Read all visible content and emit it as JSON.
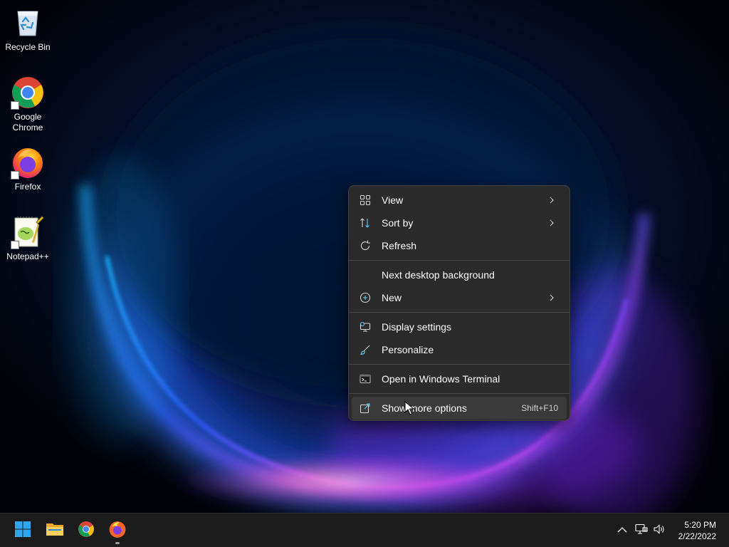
{
  "desktop": {
    "icons": [
      {
        "label": "Recycle Bin",
        "icon": "recycle-bin-icon"
      },
      {
        "label": "Google Chrome",
        "icon": "chrome-icon"
      },
      {
        "label": "Firefox",
        "icon": "firefox-icon"
      },
      {
        "label": "Notepad++",
        "icon": "notepadpp-icon"
      }
    ]
  },
  "context_menu": {
    "items": [
      {
        "label": "View",
        "icon": "grid-view-icon",
        "submenu": true
      },
      {
        "label": "Sort by",
        "icon": "sort-icon",
        "submenu": true
      },
      {
        "label": "Refresh",
        "icon": "refresh-icon",
        "submenu": false
      },
      {
        "label": "Next desktop background",
        "icon": "",
        "submenu": false
      },
      {
        "label": "New",
        "icon": "plus-circle-icon",
        "submenu": true
      },
      {
        "label": "Display settings",
        "icon": "display-settings-icon",
        "submenu": false
      },
      {
        "label": "Personalize",
        "icon": "brush-icon",
        "submenu": false
      },
      {
        "label": "Open in Windows Terminal",
        "icon": "terminal-icon",
        "submenu": false
      },
      {
        "label": "Show more options",
        "icon": "more-options-icon",
        "submenu": false,
        "accelerator": "Shift+F10",
        "highlighted": true
      }
    ]
  },
  "taskbar": {
    "apps": [
      {
        "name": "Start",
        "icon": "windows-start-icon"
      },
      {
        "name": "File Explorer",
        "icon": "file-explorer-icon"
      },
      {
        "name": "Google Chrome",
        "icon": "chrome-icon"
      },
      {
        "name": "Firefox",
        "icon": "firefox-icon",
        "running": true
      }
    ],
    "tray": {
      "icons": [
        "chevron-up-icon",
        "network-icon",
        "volume-icon"
      ]
    },
    "clock": {
      "time": "5:20 PM",
      "date": "2/22/2022"
    }
  },
  "colors": {
    "menu_bg": "#2b2b2b",
    "taskbar_bg": "#1c1c1c",
    "accent": "#60cdff"
  }
}
